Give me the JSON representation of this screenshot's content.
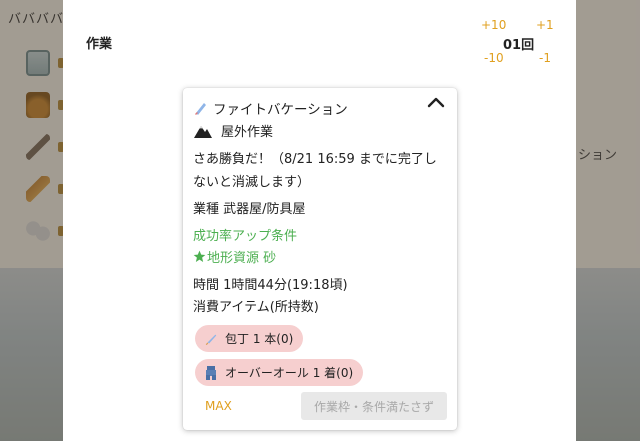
{
  "background": {
    "header_text": "ババババ",
    "right_text": "ション"
  },
  "panel": {
    "title": "作業",
    "adjust_plus_10": "+10",
    "adjust_plus_1": "+1",
    "adjust_minus_10": "-10",
    "adjust_minus_1": "-1",
    "count": "01回"
  },
  "card": {
    "title": "ファイトバケーション",
    "work_type": "屋外作業",
    "description": "さあ勝負だ！（8/21 16:59 までに完了しないと消滅します）",
    "industry": "業種 武器屋/防具屋",
    "bonus_heading": "成功率アップ条件",
    "bonus_condition": "地形資源 砂",
    "time": "時間 1時間44分(19:18頃)",
    "consumed_heading": "消費アイテム(所持数)",
    "items": [
      {
        "label": "包丁 1 本(0)",
        "icon": "knife-icon"
      },
      {
        "label": "オーバーオール 1 着(0)",
        "icon": "overalls-icon"
      }
    ],
    "max_label": "MAX",
    "execute_label": "作業枠・条件満たさず"
  },
  "colors": {
    "accent_orange": "#e0a020",
    "green": "#4caf50",
    "pill_pink": "#f6cfcf",
    "disabled_gray": "#e8e8e8"
  }
}
